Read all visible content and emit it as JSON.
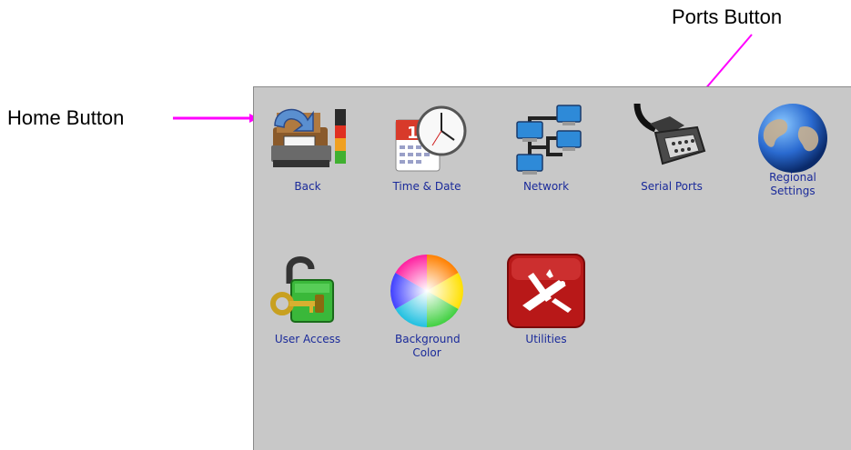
{
  "callouts": {
    "home": "Home Button",
    "ports": "Ports Button"
  },
  "settings": {
    "items": [
      {
        "label": "Back",
        "icon": "back-printer-icon"
      },
      {
        "label": "Time & Date",
        "icon": "calendar-clock-icon"
      },
      {
        "label": "Network",
        "icon": "network-icon"
      },
      {
        "label": "Serial Ports",
        "icon": "serial-connector-icon"
      },
      {
        "label": "Regional Settings",
        "icon": "globe-icon"
      },
      {
        "label": "User Access",
        "icon": "padlock-key-icon"
      },
      {
        "label": "Background Color",
        "icon": "color-wheel-icon"
      },
      {
        "label": "Utilities",
        "icon": "multitool-icon"
      }
    ]
  },
  "colors": {
    "panel": "#c8c8c8",
    "label": "#1a2a9a",
    "arrow": "#ff00ff"
  }
}
